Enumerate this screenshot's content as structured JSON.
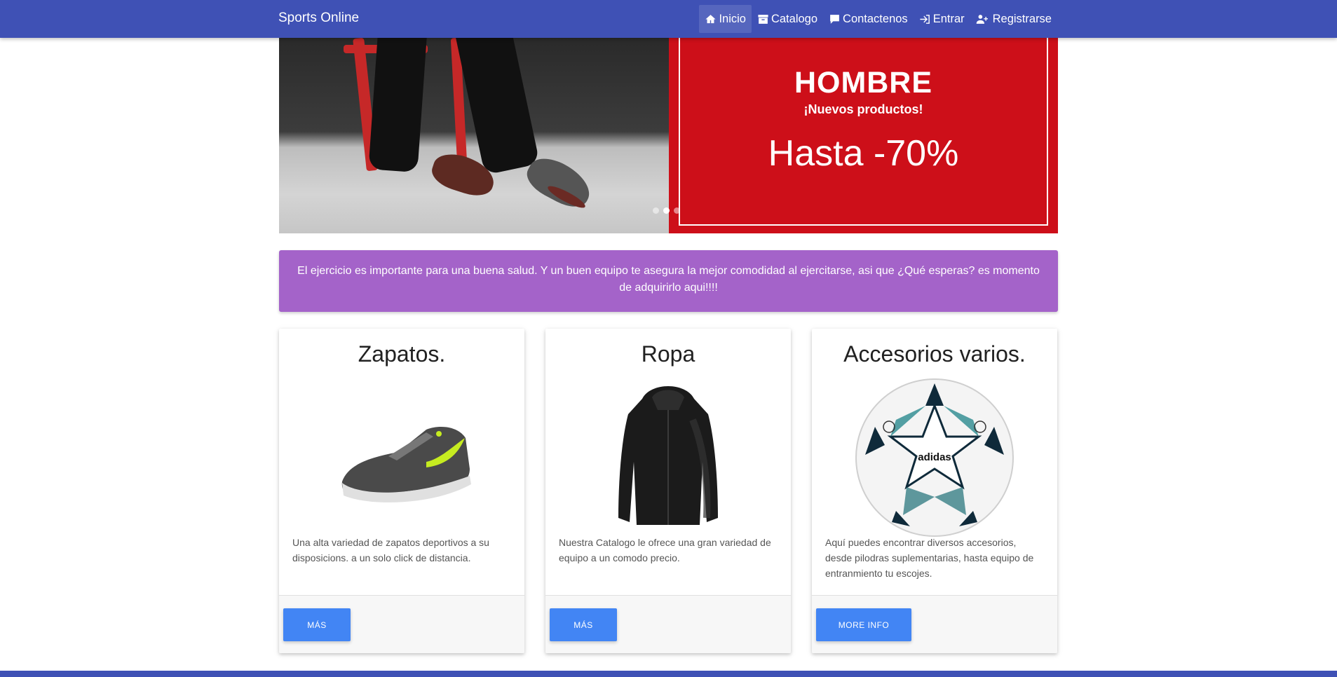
{
  "navbar": {
    "brand": "Sports Online",
    "items": [
      {
        "label": "Inicio",
        "icon": "home-icon",
        "active": true
      },
      {
        "label": "Catalogo",
        "icon": "archive-icon",
        "active": false
      },
      {
        "label": "Contactenos",
        "icon": "comment-icon",
        "active": false
      },
      {
        "label": "Entrar",
        "icon": "sign-in-icon",
        "active": false
      },
      {
        "label": "Registrarse",
        "icon": "user-plus-icon",
        "active": false
      }
    ]
  },
  "carousel": {
    "title": "HOMBRE",
    "subtitle": "¡Nuevos productos!",
    "discount": "Hasta -70%",
    "slides": 3,
    "active_slide": 2
  },
  "alert": {
    "text": "El ejercicio es importante para una buena salud. Y un buen equipo te asegura la mejor comodidad al ejercitarse, asi que ¿Qué esperas? es momento de adquirirlo aqui!!!!"
  },
  "cards": [
    {
      "title": "Zapatos.",
      "image": "sneaker-image",
      "text": "Una alta variedad de zapatos deportivos a su disposicions. a un solo click de distancia.",
      "button": "Más"
    },
    {
      "title": "Ropa",
      "image": "jacket-image",
      "text": "Nuestra Catalogo le ofrece una gran variedad de equipo a un comodo precio.",
      "button": "Más"
    },
    {
      "title": "Accesorios varios.",
      "image": "soccer-ball-image",
      "text": "Aquí puedes encontrar diversos accesorios, desde pilodras suplementarias, hasta equipo de entranmiento tu escojes.",
      "button": "More info"
    }
  ],
  "colors": {
    "navbar": "#3f51b5",
    "alert": "#a463c9",
    "promo": "#cd0f19",
    "button": "#4285f4"
  }
}
